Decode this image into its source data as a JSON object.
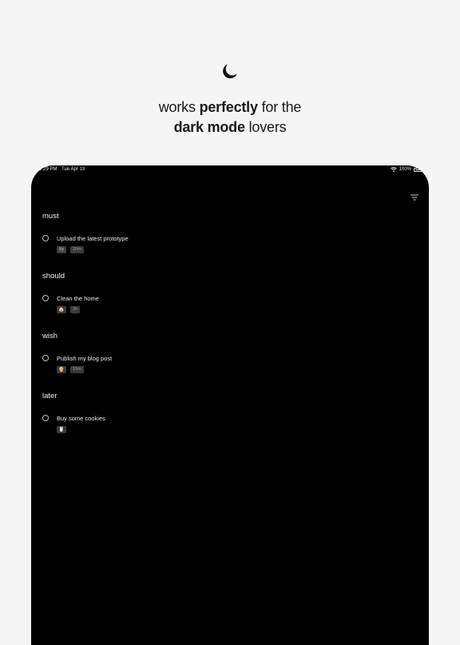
{
  "promo": {
    "icon": "crescent-moon-icon",
    "line1_pre": "works ",
    "line1_bold": "perfectly",
    "line1_post": " for the",
    "line2_bold": "dark mode",
    "line2_post": " lovers"
  },
  "status_bar": {
    "time": "9:29 PM",
    "date": "Tue Apr 13",
    "battery": "100%"
  },
  "toolbar": {
    "filter_icon": "filter-lines-icon"
  },
  "sections": [
    {
      "title": "must",
      "task": "Upload the latest prototype",
      "emoji_icon": "map-emoji-icon",
      "emoji": "🗺",
      "duration": "20m"
    },
    {
      "title": "should",
      "task": "Clean the home",
      "emoji_icon": "house-emoji-icon",
      "emoji": "🏠",
      "duration": "2h"
    },
    {
      "title": "wish",
      "task": "Publish my blog post",
      "emoji_icon": "popcorn-emoji-icon",
      "emoji": "🍿",
      "duration": "15m"
    },
    {
      "title": "later",
      "task": "Buy some cookies",
      "emoji_icon": "cup-emoji-icon",
      "emoji": "🥛",
      "duration": ""
    }
  ],
  "colors": {
    "page_background": "#f5f5f5",
    "device_background": "#000000",
    "tag_background": "#3a3a3a"
  }
}
